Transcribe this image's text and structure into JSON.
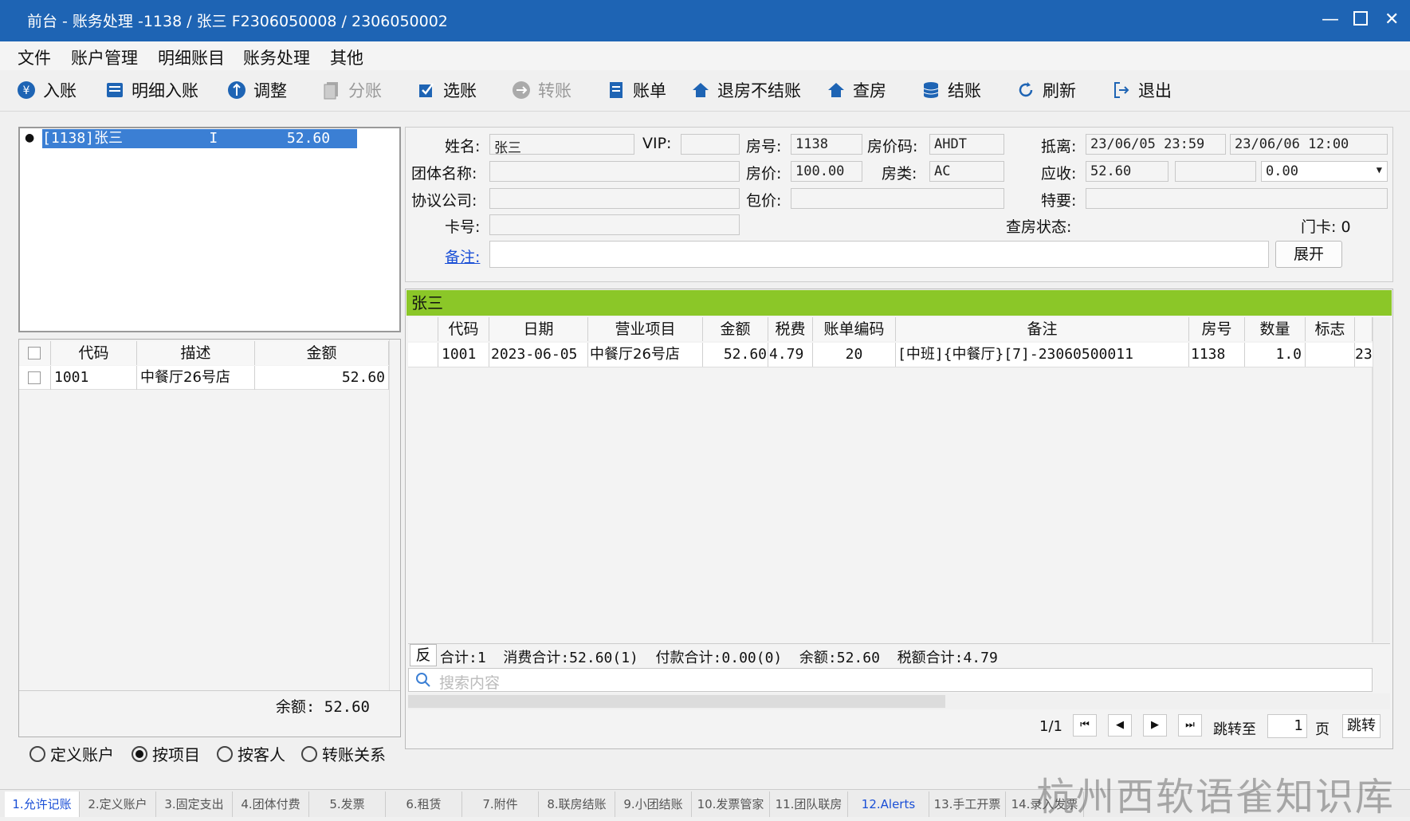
{
  "window": {
    "title": "前台 - 账务处理 -1138 / 张三 F2306050008 / 2306050002"
  },
  "menu": [
    "文件",
    "账户管理",
    "明细账目",
    "账务处理",
    "其他"
  ],
  "toolbar": [
    {
      "label": "入账",
      "icon": "yen-coin-icon"
    },
    {
      "label": "明细入账",
      "icon": "ledger-icon"
    },
    {
      "label": "调整",
      "icon": "adjust-icon"
    },
    {
      "label": "分账",
      "icon": "split-icon"
    },
    {
      "label": "选账",
      "icon": "checkbox-icon"
    },
    {
      "label": "转账",
      "icon": "transfer-icon"
    },
    {
      "label": "账单",
      "icon": "bill-icon"
    },
    {
      "label": "退房不结账",
      "icon": "house-icon"
    },
    {
      "label": "查房",
      "icon": "house-search-icon"
    },
    {
      "label": "结账",
      "icon": "database-icon"
    },
    {
      "label": "刷新",
      "icon": "refresh-icon"
    },
    {
      "label": "退出",
      "icon": "exit-icon"
    }
  ],
  "account_list": {
    "selected_item": "[1138]张三          I        52.60"
  },
  "item_grid": {
    "headers": [
      "代码",
      "描述",
      "金额"
    ],
    "rows": [
      {
        "code": "1001",
        "desc": "中餐厅26号店",
        "amount": "52.60"
      }
    ],
    "balance": "余额: 52.60"
  },
  "radios": [
    {
      "label": "定义账户",
      "checked": false
    },
    {
      "label": "按项目",
      "checked": true
    },
    {
      "label": "按客人",
      "checked": false
    },
    {
      "label": "转账关系",
      "checked": false
    }
  ],
  "guest": {
    "name_label": "姓名:",
    "name": "张三",
    "vip_label": "VIP:",
    "vip": "",
    "room_label": "房号:",
    "room": "1138",
    "rate_code_label": "房价码:",
    "rate_code": "AHDT",
    "arr_dep_label": "抵离:",
    "arrival": "23/06/05 23:59",
    "departure": "23/06/06 12:00",
    "group_label": "团体名称:",
    "group": "",
    "price_label": "房价:",
    "price": "100.00",
    "room_type_label": "房类:",
    "room_type": "AC",
    "receivable_label": "应收:",
    "receivable": "52.60",
    "receivable2": "",
    "receivable_select": "0.00",
    "company_label": "协议公司:",
    "company": "",
    "package_label": "包价:",
    "package": "",
    "special_label": "特要:",
    "special": "",
    "card_label": "卡号:",
    "card": "",
    "check_status_label": "查房状态:",
    "door_card": "门卡: 0",
    "remark_label": "备注:",
    "remark": "",
    "expand_button": "展开"
  },
  "ledger": {
    "guest_header": "张三",
    "headers": [
      "代码",
      "日期",
      "营业项目",
      "金额",
      "税费",
      "账单编码",
      "备注",
      "房号",
      "数量",
      "标志"
    ],
    "rows": [
      {
        "code": "1001",
        "date": "2023-06-05",
        "item": "中餐厅26号店",
        "amount": "52.60",
        "tax": "4.79",
        "bill": "20",
        "remark": "[中班]{中餐厅}[7]-23060500011",
        "room": "1138",
        "qty": "1.0",
        "flag": "",
        "extra": "23"
      }
    ],
    "reverse_button": "反",
    "summary": "合计:1  消费合计:52.60(1)  付款合计:0.00(0)  余额:52.60  税额合计:4.79",
    "search_placeholder": "搜索内容",
    "page_info": "1/1",
    "jump_label": "跳转至",
    "jump_value": "1",
    "page_unit": "页",
    "jump_button": "跳转"
  },
  "bottom_tabs": [
    "1.允许记账",
    "2.定义账户",
    "3.固定支出",
    "4.团体付费",
    "5.发票",
    "6.租赁",
    "7.附件",
    "8.联房结账",
    "9.小团结账",
    "10.发票管家",
    "11.团队联房",
    "12.Alerts",
    "13.手工开票",
    "14.录入发票"
  ],
  "watermark": "杭州西软语雀知识库",
  "colors": {
    "title_bar": "#1e64b4",
    "guest_header": "#8bc728",
    "selection": "#3b7fd4",
    "link": "#1a4fd6"
  }
}
